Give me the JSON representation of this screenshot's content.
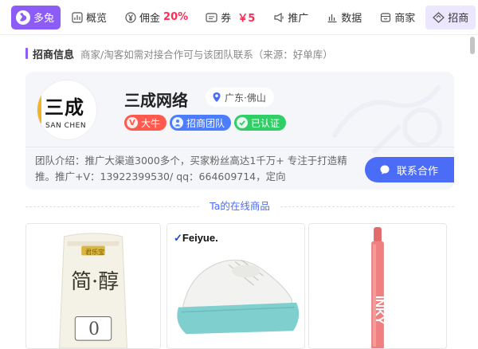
{
  "tabs": [
    {
      "label": "多兔",
      "icon": "rabbit-logo-icon",
      "highlight": ""
    },
    {
      "label": "概览",
      "icon": "overview-icon",
      "highlight": ""
    },
    {
      "label": "佣金",
      "icon": "yen-icon",
      "highlight": "20%"
    },
    {
      "label": "券",
      "icon": "coupon-icon",
      "highlight": "￥5"
    },
    {
      "label": "推广",
      "icon": "megaphone-icon",
      "highlight": ""
    },
    {
      "label": "数据",
      "icon": "bar-chart-icon",
      "highlight": ""
    },
    {
      "label": "商家",
      "icon": "shop-icon",
      "highlight": ""
    },
    {
      "label": "招商",
      "icon": "diamond-icon",
      "highlight": ""
    }
  ],
  "section": {
    "title": "招商信息",
    "note": "商家/淘客如需对接合作可与该团队联系（来源：好单库）"
  },
  "team": {
    "avatar_text_cn": "三成",
    "avatar_text_en": "SAN CHEN",
    "name": "三成网络",
    "location": "广东·佛山",
    "badges": [
      "大牛",
      "招商团队",
      "已认证"
    ],
    "intro_label": "团队介绍：",
    "intro": "推广大渠道3000多个，买家粉丝高达1千万+ 专注于打造精推。推广+V：13922399530/ qq：664609714，定向",
    "contact_button": "联系合作"
  },
  "online_title": "Ta的在线商品",
  "products": [
    {
      "name": "product-1",
      "pack_main": "简·醇",
      "pack_sub": "0",
      "pack_brand": "君乐宝"
    },
    {
      "name": "product-2",
      "brand": "Feiyue."
    },
    {
      "name": "product-3",
      "pack_text": "INKY"
    }
  ],
  "colors": {
    "brand_purple": "#8b5cf6",
    "accent_red": "#ff2d55",
    "primary_blue": "#4a6cf7",
    "badge_red": "#ff5a4e",
    "badge_blue": "#4c7dff",
    "badge_green": "#2fcf66"
  }
}
